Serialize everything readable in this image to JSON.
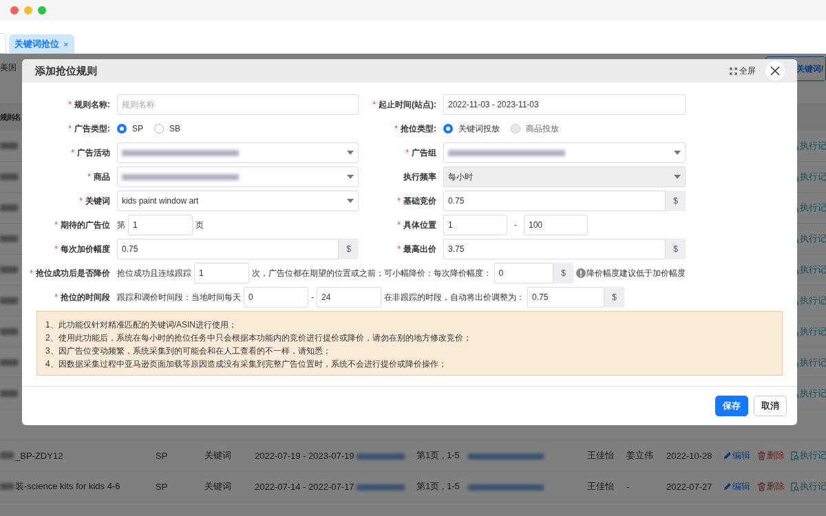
{
  "tabs": [
    {
      "label": "关键词抢位",
      "close": "×",
      "selected": true
    }
  ],
  "page": {
    "region": "美国",
    "top_button": "关键词/",
    "header": "规则名",
    "covered_rows": [
      {
        "action": "执行记"
      },
      {
        "action": "执行记"
      },
      {
        "action": "执行记"
      },
      {
        "action": "执行记"
      },
      {
        "action": "执行记"
      },
      {
        "action": "执行记"
      },
      {
        "action": "执行记"
      },
      {
        "action": "执行记"
      },
      {
        "action": "执行记"
      }
    ],
    "rows": [
      {
        "name": "_BP-ZDY12",
        "type": "SP",
        "match": "关键词",
        "dates": "2022-07-19 - 2023-07-19",
        "position": "第1页 , 1-5",
        "creator": "王佳怡",
        "editor": "姜立伟",
        "date": "2022-10-28",
        "edit": "编辑",
        "delete": "删除",
        "record": "执行记"
      },
      {
        "name": "装-science kits for kids 4-6",
        "type": "SP",
        "match": "关键词",
        "dates": "2022-07-14 - 2022-07-17",
        "position": "第1页 , 1-5",
        "creator": "王佳怡",
        "editor": "-",
        "date": "2022-07-27",
        "edit": "编辑",
        "delete": "删除",
        "record": "执行记"
      }
    ]
  },
  "dialog": {
    "title": "添加抢位规则",
    "fullscreen": "全屏",
    "left_fields": [
      {
        "label": "规则名称:",
        "marker": "*",
        "kind": "text",
        "placeholder": "规则名称"
      },
      {
        "label": "广告类型:",
        "marker": "*",
        "kind": "radio",
        "options": [
          {
            "label": "SP",
            "selected": true,
            "disabled": false
          },
          {
            "label": "SB",
            "selected": false,
            "disabled": false
          }
        ]
      },
      {
        "label": "广告活动",
        "marker": "*",
        "kind": "select",
        "redacted": true
      },
      {
        "label": "商品",
        "marker": "*",
        "kind": "select",
        "redacted": true
      },
      {
        "label": "关键词",
        "marker": "*",
        "kind": "select",
        "value": "kids paint window art"
      },
      {
        "label": "期待的广告位",
        "marker": "*",
        "kind": "page",
        "prefix": "第",
        "value": "1",
        "suffix": "页"
      },
      {
        "label": "每次加价幅度",
        "marker": "*",
        "kind": "addon",
        "value": "0.75",
        "addon": "$"
      }
    ],
    "right_fields": [
      {
        "label": "起止时间(站点):",
        "marker": "*",
        "kind": "text",
        "value": "2022-11-03 - 2023-11-03"
      },
      {
        "label": "抢位类型:",
        "marker": "*",
        "kind": "radio",
        "options": [
          {
            "label": "关键词投放",
            "selected": true,
            "disabled": false
          },
          {
            "label": "商品投放",
            "selected": false,
            "disabled": true
          }
        ]
      },
      {
        "label": "广告组",
        "marker": "*",
        "kind": "select",
        "redacted": true
      },
      {
        "label": "执行频率",
        "kind": "select",
        "value": "每小时",
        "disabled": true
      },
      {
        "label": "基础竞价",
        "marker": "*",
        "kind": "addon",
        "value": "0.75",
        "addon": "$"
      },
      {
        "label": "具体位置",
        "marker": "*",
        "kind": "range",
        "from": "1",
        "separator": "-",
        "to": "100"
      },
      {
        "label": "最高出价",
        "marker": "*",
        "kind": "addon",
        "value": "3.75",
        "addon": "$"
      }
    ],
    "wide_fields": [
      {
        "label": "抢位成功后是否降价",
        "marker": "*",
        "parts": [
          {
            "kind": "text",
            "text": "抢位成功且连续跟踪"
          },
          {
            "kind": "input",
            "value": "1"
          },
          {
            "kind": "text",
            "text": "次，广告位都在期望的位置或之前；可小幅降价：每次降价幅度："
          },
          {
            "kind": "addon",
            "value": "0",
            "addon": "$"
          },
          {
            "kind": "hint",
            "text": "降价幅度建议低于加价幅度"
          }
        ]
      },
      {
        "label": "抢位的时间段",
        "marker": "*",
        "parts": [
          {
            "kind": "text",
            "text": "跟踪和调价时间段：当地时间每天"
          },
          {
            "kind": "input",
            "value": "0"
          },
          {
            "kind": "text",
            "text": "-"
          },
          {
            "kind": "input",
            "value": "24"
          },
          {
            "kind": "text",
            "text": "在非跟踪的时段，自动将出价调整为："
          },
          {
            "kind": "addon",
            "value": "0.75",
            "addon": "$"
          }
        ]
      }
    ],
    "notes": [
      "1、此功能仅针对精准匹配的关键词/ASIN进行使用；",
      "2、使用此功能后，系统在每小时的抢位任务中只会根据本功能内的竞价进行提价或降价，请勿在别的地方修改竞价；",
      "3、因广告位变动频繁，系统采集到的可能会和在人工查看的不一样，请知悉；",
      "4、因数据采集过程中亚马逊页面加载等原因造成没有采集到完整广告位置时，系统不会进行提价或降价操作；"
    ],
    "buttons": [
      {
        "label": "保存",
        "kind": "primary"
      },
      {
        "label": "取消",
        "kind": "default"
      }
    ]
  }
}
